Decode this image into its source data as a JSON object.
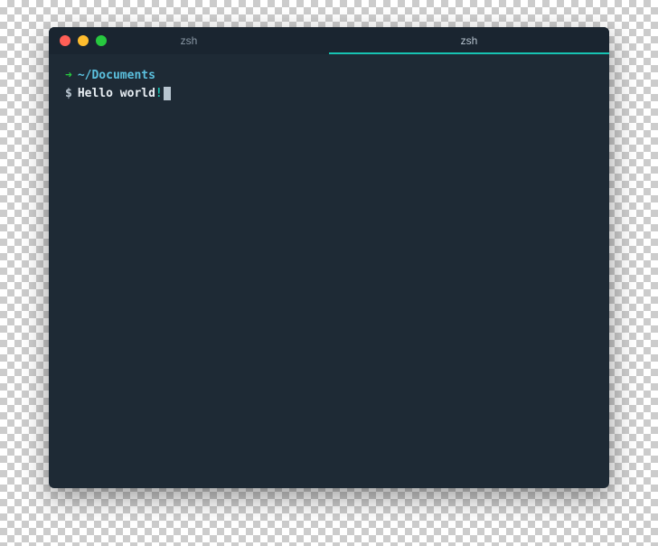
{
  "window": {
    "traffic_lights": {
      "close_color": "#ff5f56",
      "minimize_color": "#ffbd2e",
      "maximize_color": "#27c93f"
    }
  },
  "tabs": [
    {
      "label": "zsh",
      "active": false
    },
    {
      "label": "zsh",
      "active": true
    }
  ],
  "terminal": {
    "prompt_arrow": "➜",
    "prompt_arrow_color": "#27c93f",
    "cwd": "~/Documents",
    "cwd_color": "#5bc0de",
    "prompt_symbol": "$",
    "command": "Hello world!",
    "bang_color": "#17c3b2"
  }
}
